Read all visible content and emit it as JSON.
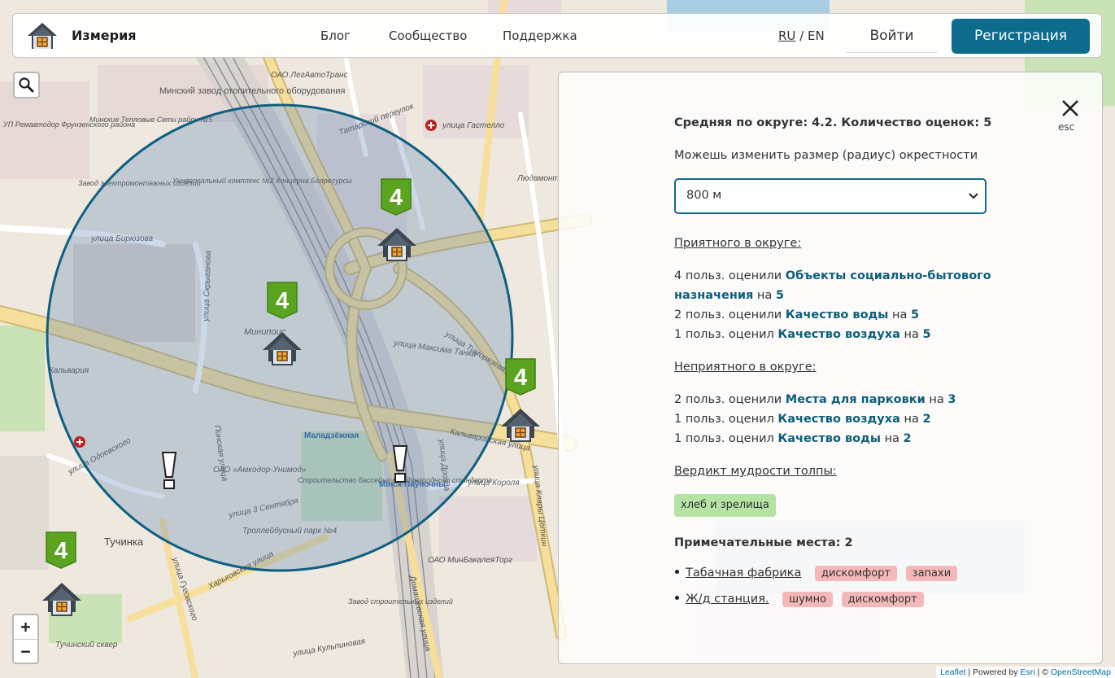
{
  "header": {
    "brand": "Измерия",
    "nav": [
      "Блог",
      "Сообщество",
      "Поддержка"
    ],
    "lang_ru": "RU",
    "lang_sep": "/",
    "lang_en": "EN",
    "login": "Войти",
    "register": "Регистрация"
  },
  "map": {
    "labels": [
      "улица Бирюзова",
      "улица Скрыганова",
      "Минипоис",
      "Кальварийская улица",
      "Маладзёжная",
      "Мінск-Паўночны",
      "улица Тимирязева",
      "улица Максима Танка",
      "Тучинка",
      "улица Гуговского",
      "Домашевская улица",
      "улица Клары Цеткин",
      "Тучинский сквер",
      "Троллейбусный парк №4",
      "ОАО «Амкодор-Унимод»",
      "Строительство бассейна международного стандарта",
      "улица 3 Сентября",
      "Харьковская улица",
      "Завод строительных изделий",
      "улица Короля",
      "улица Дрозда",
      "ОАО МинБакалеяТорг",
      "Людамонт",
      "Минский завод отопительного оборудования",
      "ОАО ЛегАвтоТранс",
      "Татарский переулок",
      "улица Гастелло",
      "Пинская улица",
      "улица Одоевского",
      "Кальвария",
      "Универсальный комплекс №2 Концерна Белресурсы",
      "Минские Тепловые Сети район №5",
      "УП Ремавтодор Фрунзенского района",
      "Завод электромонтажных изделий",
      "улица Кульпиновая"
    ],
    "markers_rating": [
      "4",
      "4",
      "4",
      "4"
    ],
    "warning_mark": "!"
  },
  "panel": {
    "esc": "esc",
    "average": "Средняя по округе: 4.2. Количество оценок: 5",
    "radius_hint": "Можешь изменить размер (радиус) окрестности",
    "radius_value": "800 м",
    "pleasant_heading": "Приятного в округе:",
    "pleasant": [
      {
        "prefix": "4 польз. оценили",
        "item": "Объекты социально-бытового назначения",
        "on": "на",
        "score": "5"
      },
      {
        "prefix": "2 польз. оценили",
        "item": "Качество воды",
        "on": "на",
        "score": "5"
      },
      {
        "prefix": "1 польз. оценил",
        "item": "Качество воздуха",
        "on": "на",
        "score": "5"
      }
    ],
    "unpleasant_heading": "Неприятного в округе:",
    "unpleasant": [
      {
        "prefix": "2 польз. оценили",
        "item": "Места для парковки",
        "on": "на",
        "score": "3"
      },
      {
        "prefix": "1 польз. оценил",
        "item": "Качество воздуха",
        "on": "на",
        "score": "2"
      },
      {
        "prefix": "1 польз. оценил",
        "item": "Качество воды",
        "on": "на",
        "score": "2"
      }
    ],
    "verdict_heading": "Вердикт мудрости толпы:",
    "verdict_tag": "хлеб и зрелища",
    "places_heading": "Примечательные места: 2",
    "places": [
      {
        "name": "Табачная фабрика",
        "tags": [
          "дискомфорт",
          "запахи"
        ]
      },
      {
        "name": "Ж/д станция.",
        "tags": [
          "шумно",
          "дискомфорт"
        ]
      }
    ]
  },
  "controls": {
    "zoom_in": "+",
    "zoom_out": "−"
  },
  "attribution": {
    "leaflet": "Leaflet",
    "sep1": " | Powered by ",
    "esri": "Esri",
    "sep2": " | © ",
    "osm": "OpenStreetMap"
  },
  "colors": {
    "accent": "#0d6b8d",
    "marker_green": "#5aa41f",
    "tag_green": "#b5e3a4",
    "tag_red": "#f4b8b8"
  }
}
